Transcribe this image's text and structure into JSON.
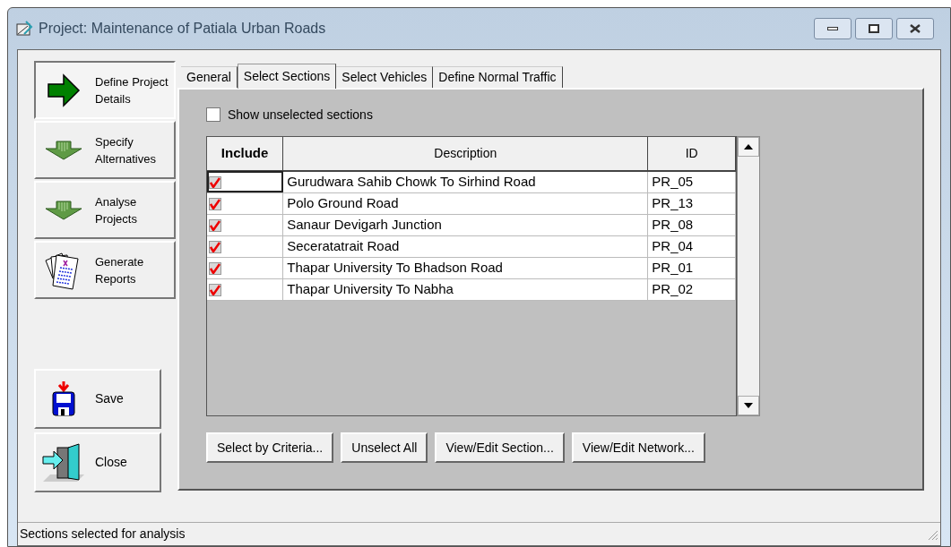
{
  "window": {
    "title": "Project: Maintenance of Patiala Urban Roads"
  },
  "nav": [
    {
      "kind": "define",
      "label": "Define Project Details",
      "selected": true
    },
    {
      "kind": "specify",
      "label": "Specify Alternatives",
      "selected": false
    },
    {
      "kind": "analyse",
      "label": "Analyse Projects",
      "selected": false
    },
    {
      "kind": "reports",
      "label": "Generate Reports",
      "selected": false
    }
  ],
  "actions": [
    {
      "kind": "save",
      "label": "Save"
    },
    {
      "kind": "close",
      "label": "Close"
    }
  ],
  "tabs": [
    {
      "label": "General",
      "selected": false
    },
    {
      "label": "Select Sections",
      "selected": true
    },
    {
      "label": "Select Vehicles",
      "selected": false
    },
    {
      "label": "Define Normal Traffic",
      "selected": false
    }
  ],
  "show_unselected": {
    "label": "Show unselected sections",
    "checked": false
  },
  "table": {
    "columns": [
      "Include",
      "Description",
      "ID"
    ],
    "rows": [
      {
        "include": true,
        "description": "Gurudwara Sahib Chowk To Sirhind Road",
        "id": "PR_05"
      },
      {
        "include": true,
        "description": "Polo Ground Road",
        "id": "PR_13"
      },
      {
        "include": true,
        "description": "Sanaur Devigarh Junction",
        "id": "PR_08"
      },
      {
        "include": true,
        "description": "Seceratatrait Road",
        "id": "PR_04"
      },
      {
        "include": true,
        "description": "Thapar University To Bhadson Road",
        "id": "PR_01"
      },
      {
        "include": true,
        "description": "Thapar University To Nabha",
        "id": "PR_02"
      }
    ]
  },
  "buttons": [
    "Select by Criteria...",
    "Unselect All",
    "View/Edit Section...",
    "View/Edit Network..."
  ],
  "status_bar": "Sections selected for analysis"
}
